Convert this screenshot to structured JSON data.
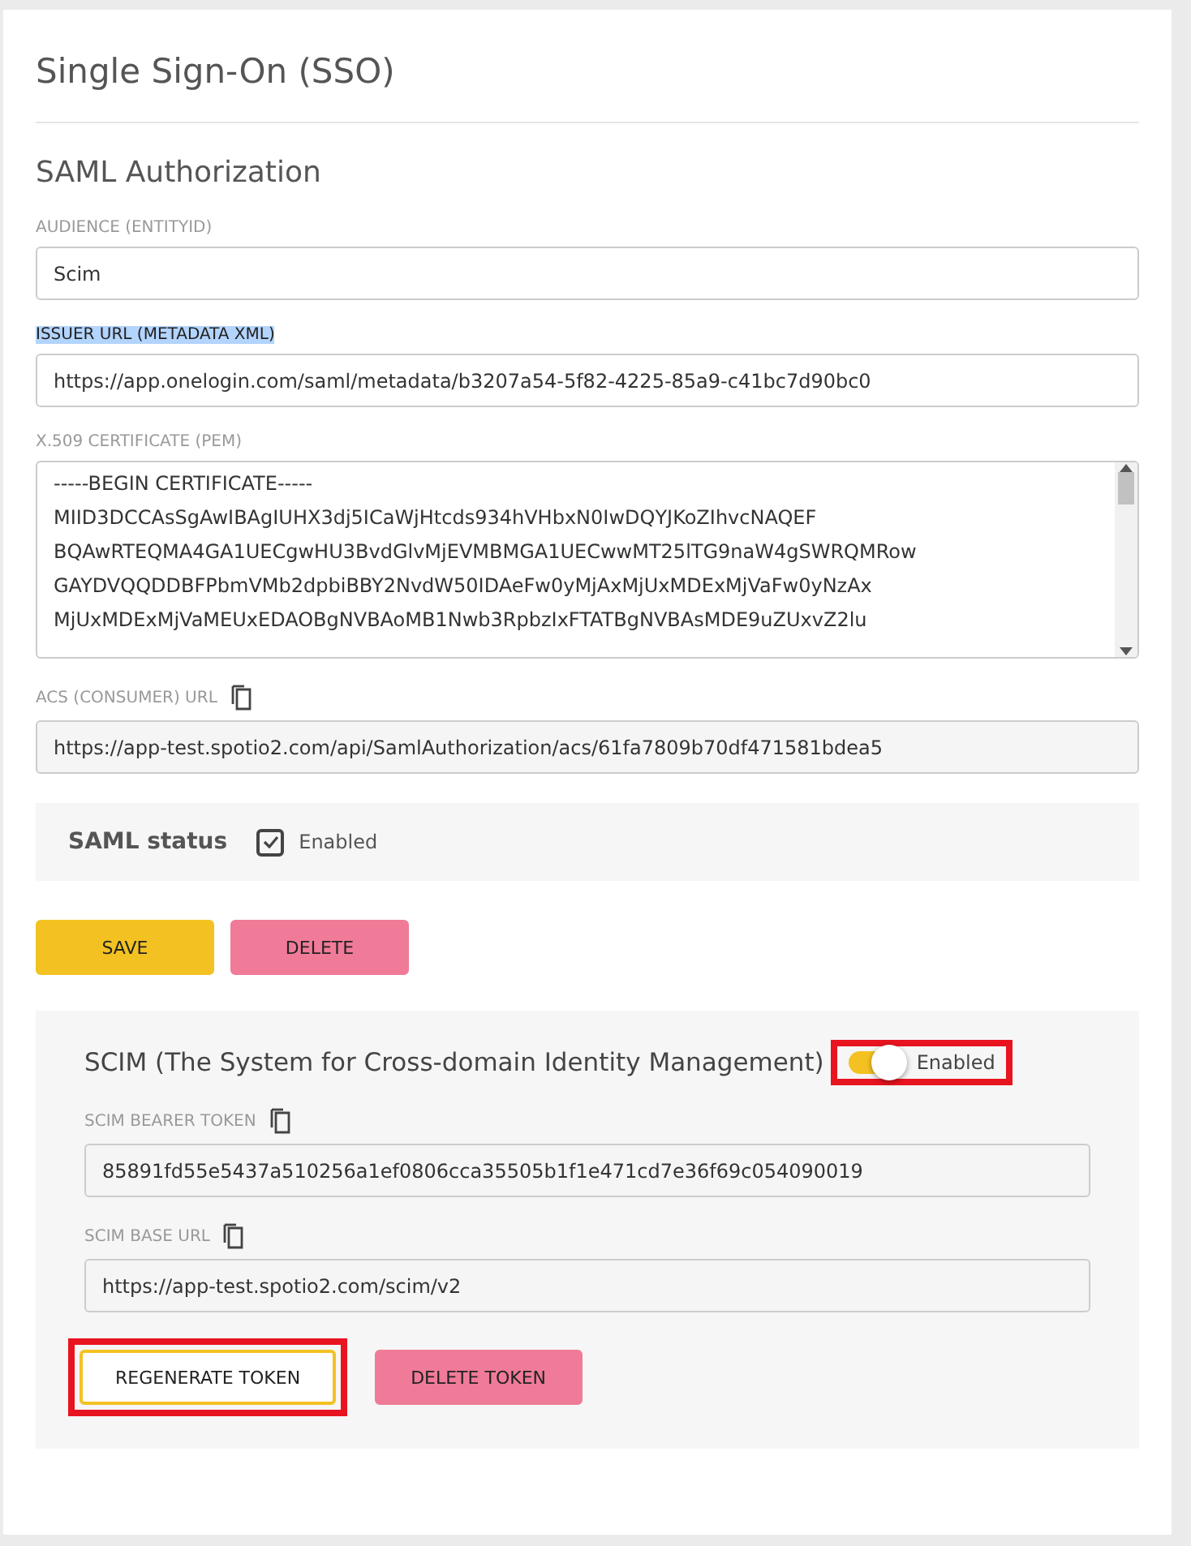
{
  "title": "Single Sign-On (SSO)",
  "saml": {
    "heading": "SAML Authorization",
    "fields": [
      {
        "kind": "input",
        "label": "AUDIENCE (ENTITYID)",
        "value": "Scim",
        "highlighted": false,
        "copyable": false
      },
      {
        "kind": "input",
        "label": "ISSUER URL (METADATA XML)",
        "value": "https://app.onelogin.com/saml/metadata/b3207a54-5f82-4225-85a9-c41bc7d90bc0",
        "highlighted": true,
        "copyable": false
      },
      {
        "kind": "textarea",
        "label": "X.509 CERTIFICATE (PEM)",
        "lines": [
          "-----BEGIN CERTIFICATE-----",
          "MIID3DCCAsSgAwIBAgIUHX3dj5ICaWjHtcds934hVHbxN0IwDQYJKoZIhvcNAQEF",
          "BQAwRTEQMA4GA1UECgwHU3BvdGlvMjEVMBMGA1UECwwMT25lTG9naW4gSWRQMRow",
          "GAYDVQQDDBFPbmVMb2dpbiBBY2NvdW50IDAeFw0yMjAxMjUxMDExMjVaFw0yNzAx",
          "MjUxMDExMjVaMEUxEDAOBgNVBAoMB1Nwb3RpbzIxFTATBgNVBAsMDE9uZUxvZ2lu"
        ],
        "highlighted": false,
        "copyable": false
      },
      {
        "kind": "readonly",
        "label": "ACS (CONSUMER) URL",
        "value": "https://app-test.spotio2.com/api/SamlAuthorization/acs/61fa7809b70df471581bdea5",
        "highlighted": false,
        "copyable": true
      }
    ],
    "status": {
      "label": "SAML status",
      "option": "Enabled",
      "checked": true
    },
    "buttons": [
      {
        "kind": "primary",
        "label": "SAVE"
      },
      {
        "kind": "danger",
        "label": "DELETE"
      }
    ]
  },
  "scim": {
    "heading": "SCIM (The System for Cross-domain Identity Management)",
    "toggle": {
      "label": "Enabled",
      "on": true,
      "annotated": true
    },
    "fields": [
      {
        "kind": "readonly",
        "label": "SCIM BEARER TOKEN",
        "value": "85891fd55e5437a510256a1ef0806cca35505b1f1e471cd7e36f69c054090019",
        "highlighted": false,
        "copyable": true
      },
      {
        "kind": "readonly",
        "label": "SCIM BASE URL",
        "value": "https://app-test.spotio2.com/scim/v2",
        "highlighted": false,
        "copyable": true
      }
    ],
    "buttons": [
      {
        "kind": "outline",
        "label": "REGENERATE TOKEN",
        "annotated": true
      },
      {
        "kind": "danger",
        "label": "DELETE TOKEN",
        "annotated": false
      }
    ]
  }
}
